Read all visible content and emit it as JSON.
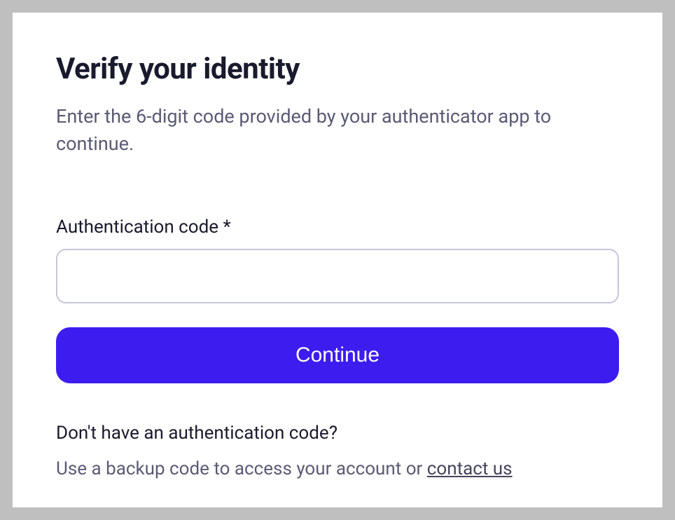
{
  "title": "Verify your identity",
  "subtitle": "Enter the 6-digit code provided by your authenticator app to continue.",
  "form": {
    "code_label": "Authentication code *",
    "code_value": "",
    "continue_label": "Continue"
  },
  "help": {
    "heading": "Don't have an authentication code?",
    "text_prefix": "Use a backup code to access your account or ",
    "contact_link": "contact us"
  }
}
